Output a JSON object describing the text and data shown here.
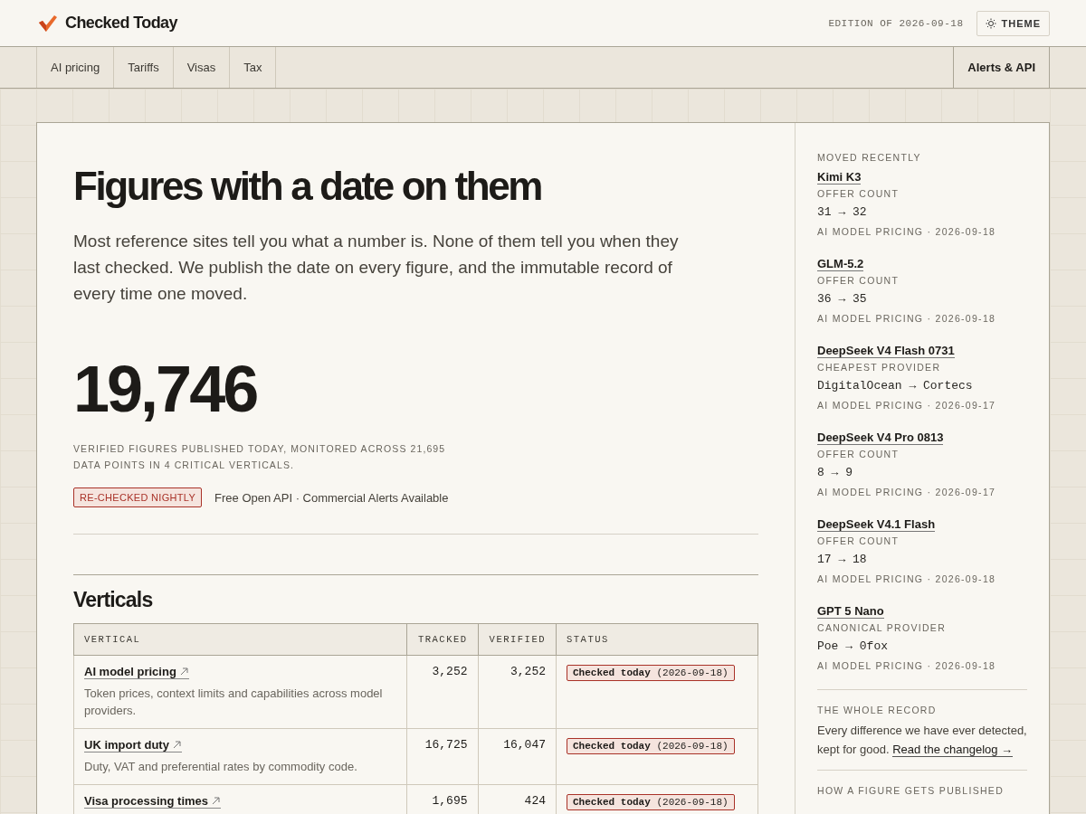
{
  "header": {
    "brand": "Checked Today",
    "edition": "EDITION OF 2026-09-18",
    "theme_button": "THEME"
  },
  "nav": {
    "items": [
      "AI pricing",
      "Tariffs",
      "Visas",
      "Tax"
    ],
    "right_item": "Alerts & API"
  },
  "hero": {
    "title": "Figures with a date on them",
    "intro": "Most reference sites tell you what a number is. None of them tell you when they last checked. We publish the date on every figure, and the immutable record of every time one moved.",
    "big_number": "19,746",
    "caption": "VERIFIED FIGURES PUBLISHED TODAY, MONITORED ACROSS 21,695 DATA POINTS IN 4 CRITICAL VERTICALS.",
    "badge": "RE-CHECKED NIGHTLY",
    "badge_note": "Free Open API · Commercial Alerts Available"
  },
  "verticals": {
    "title": "Verticals",
    "columns": [
      "VERTICAL",
      "TRACKED",
      "VERIFIED",
      "STATUS"
    ],
    "rows": [
      {
        "name": "AI model pricing",
        "description": "Token prices, context limits and capabilities across model providers.",
        "tracked": "3,252",
        "verified": "3,252",
        "status": "Checked today",
        "status_date": "(2026-09-18)"
      },
      {
        "name": "UK import duty",
        "description": "Duty, VAT and preferential rates by commodity code.",
        "tracked": "16,725",
        "verified": "16,047",
        "status": "Checked today",
        "status_date": "(2026-09-18)"
      },
      {
        "name": "Visa processing times",
        "tracked": "1,695",
        "verified": "424",
        "status": "Checked today",
        "status_date": "(2026-09-18)"
      }
    ]
  },
  "sidebar": {
    "moved_title": "MOVED RECENTLY",
    "moves": [
      {
        "name": "Kimi K3",
        "field": "OFFER COUNT",
        "from": "31",
        "arrow": "→",
        "to": "32",
        "meta": "AI MODEL PRICING · 2026-09-18"
      },
      {
        "name": "GLM-5.2",
        "field": "OFFER COUNT",
        "from": "36",
        "arrow": "→",
        "to": "35",
        "meta": "AI MODEL PRICING · 2026-09-18"
      },
      {
        "name": "DeepSeek V4 Flash 0731",
        "field": "CHEAPEST PROVIDER",
        "from": "DigitalOcean",
        "arrow": "→",
        "to": "Cortecs",
        "meta": "AI MODEL PRICING · 2026-09-17"
      },
      {
        "name": "DeepSeek V4 Pro 0813",
        "field": "OFFER COUNT",
        "from": "8",
        "arrow": "→",
        "to": "9",
        "meta": "AI MODEL PRICING · 2026-09-17"
      },
      {
        "name": "DeepSeek V4.1 Flash",
        "field": "OFFER COUNT",
        "from": "17",
        "arrow": "→",
        "to": "18",
        "meta": "AI MODEL PRICING · 2026-09-18"
      },
      {
        "name": "GPT 5 Nano",
        "field": "CANONICAL PROVIDER",
        "from": "Poe",
        "arrow": "→",
        "to": "0fox",
        "meta": "AI MODEL PRICING · 2026-09-18"
      }
    ],
    "record_title": "THE WHOLE RECORD",
    "record_text": "Every difference we have ever detected, kept for good.",
    "record_link": "Read the changelog →",
    "next_title": "HOW A FIGURE GETS PUBLISHED"
  }
}
